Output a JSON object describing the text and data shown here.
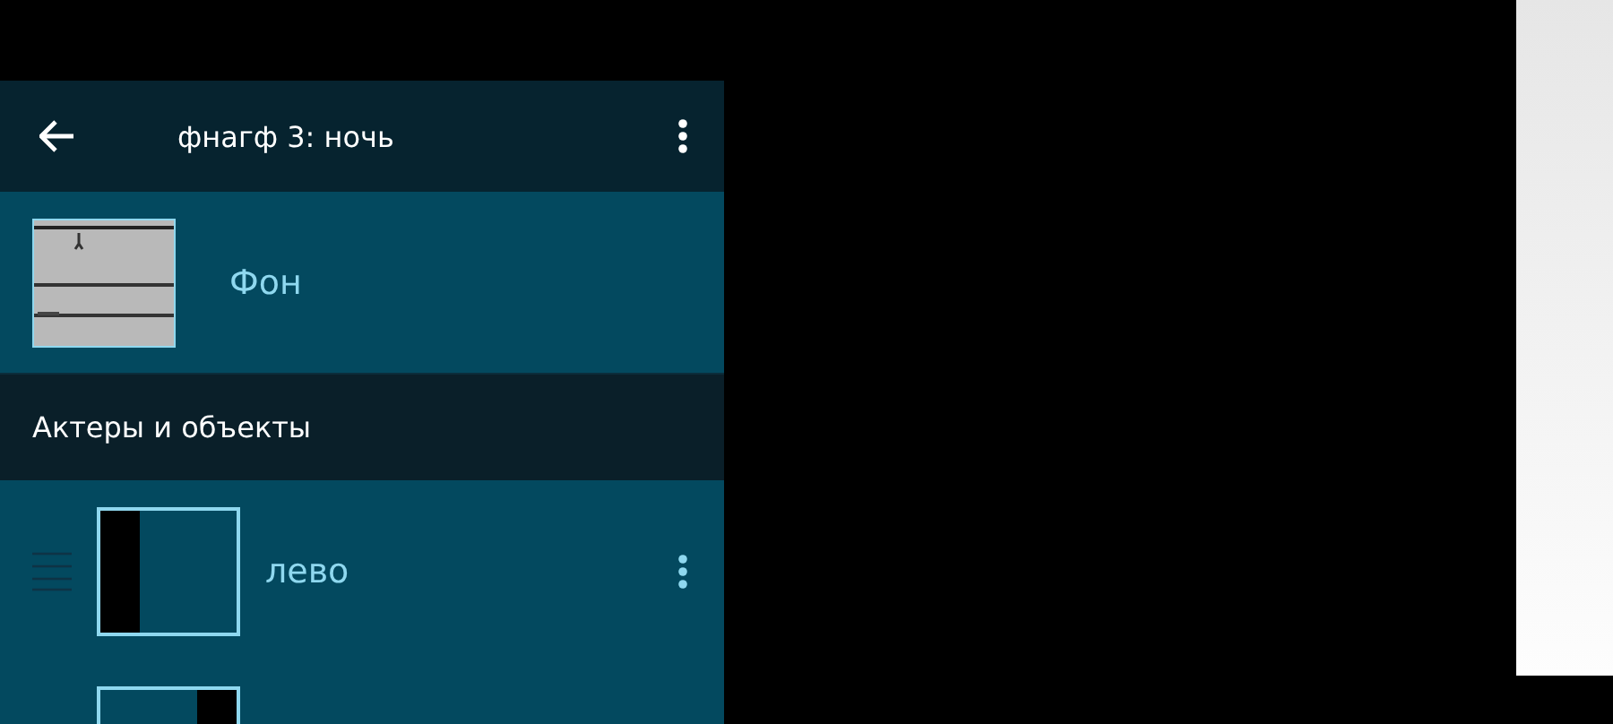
{
  "toolbar": {
    "title": "фнагф 3: ночь"
  },
  "background": {
    "label": "Фон"
  },
  "section": {
    "title": "Актеры и объекты"
  },
  "items": [
    {
      "label": "лево",
      "kind": "leftbar"
    },
    {
      "kind": "rightbar"
    }
  ]
}
